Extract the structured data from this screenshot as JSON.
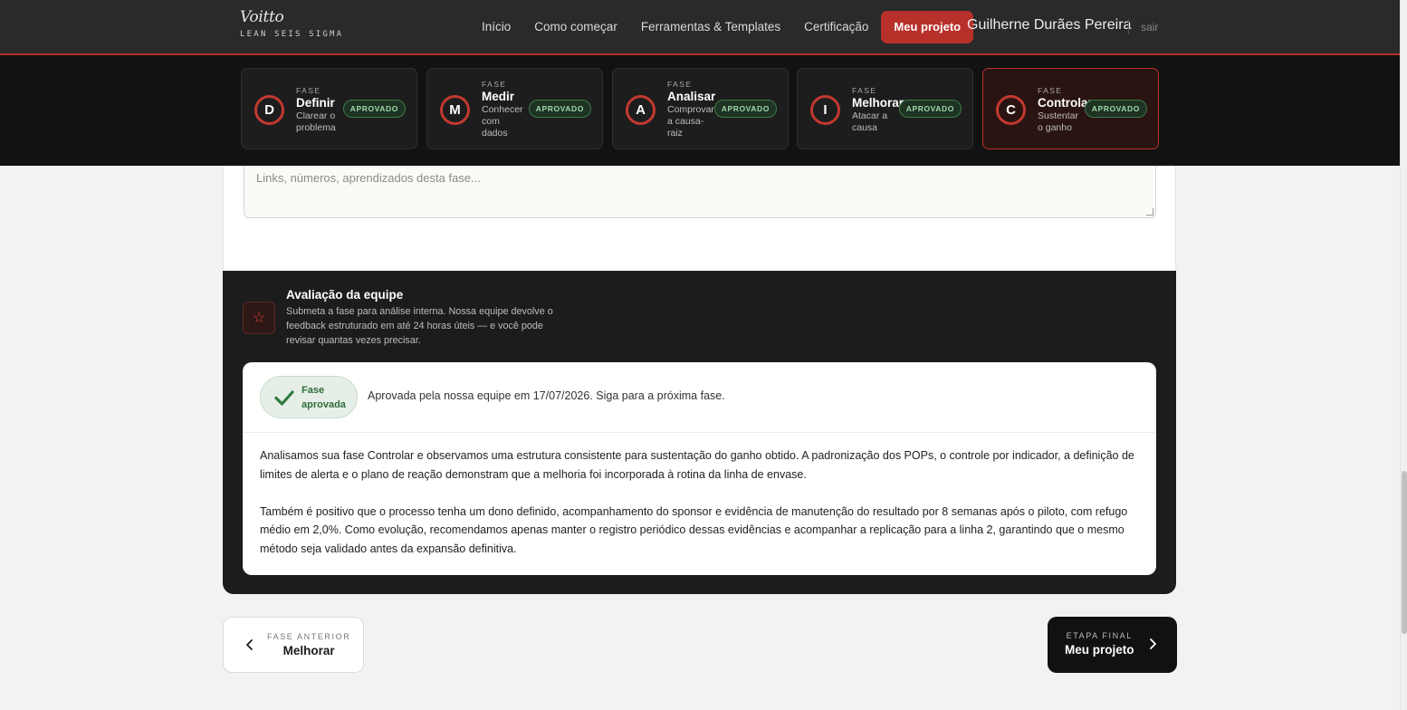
{
  "brand": {
    "name": "Voitto",
    "subtitle": "LEAN SEIS SIGMA"
  },
  "nav": {
    "items": [
      "Início",
      "Como começar",
      "Ferramentas & Templates",
      "Certificação"
    ],
    "cta": "Meu projeto",
    "user_name": "Guilherne Durães Pereira",
    "logout": "sair"
  },
  "phases": [
    {
      "kicker": "FASE",
      "letter": "D",
      "name": "Definir",
      "desc": "Clarear o problema",
      "status": "APROVADO",
      "active": false
    },
    {
      "kicker": "FASE",
      "letter": "M",
      "name": "Medir",
      "desc": "Conhecer com dados",
      "status": "APROVADO",
      "active": false
    },
    {
      "kicker": "FASE",
      "letter": "A",
      "name": "Analisar",
      "desc": "Comprovar a causa-raiz",
      "status": "APROVADO",
      "active": false
    },
    {
      "kicker": "FASE",
      "letter": "I",
      "name": "Melhorar",
      "desc": "Atacar a causa",
      "status": "APROVADO",
      "active": false
    },
    {
      "kicker": "FASE",
      "letter": "C",
      "name": "Controlar",
      "desc": "Sustentar o ganho",
      "status": "APROVADO",
      "active": true
    }
  ],
  "notes": {
    "placeholder": "Links, números, aprendizados desta fase..."
  },
  "review": {
    "title": "Avaliação da equipe",
    "subtitle": "Submeta a fase para análise interna. Nossa equipe devolve o feedback estruturado em até 24 horas úteis — e você pode revisar quantas vezes precisar.",
    "status_pill": "Fase aprovada",
    "status_text": "Aprovada pela nossa equipe em 17/07/2026. Siga para a próxima fase.",
    "paragraphs": [
      "Analisamos sua fase Controlar e observamos uma estrutura consistente para sustentação do ganho obtido. A padronização dos POPs, o controle por indicador, a definição de limites de alerta e o plano de reação demonstram que a melhoria foi incorporada à rotina da linha de envase.",
      "Também é positivo que o processo tenha um dono definido, acompanhamento do sponsor e evidência de manutenção do resultado por 8 semanas após o piloto, com refugo médio em 2,0%. Como evolução, recomendamos apenas manter o registro periódico dessas evidências e acompanhar a replicação para a linha 2, garantindo que o mesmo método seja validado antes da expansão definitiva."
    ]
  },
  "footer_nav": {
    "prev_kicker": "FASE ANTERIOR",
    "prev_label": "Melhorar",
    "next_kicker": "ETAPA FINAL",
    "next_label": "Meu projeto"
  },
  "colors": {
    "accent": "#b8302a",
    "approved": "#2f6b3a",
    "dark": "#1c1c1c"
  }
}
